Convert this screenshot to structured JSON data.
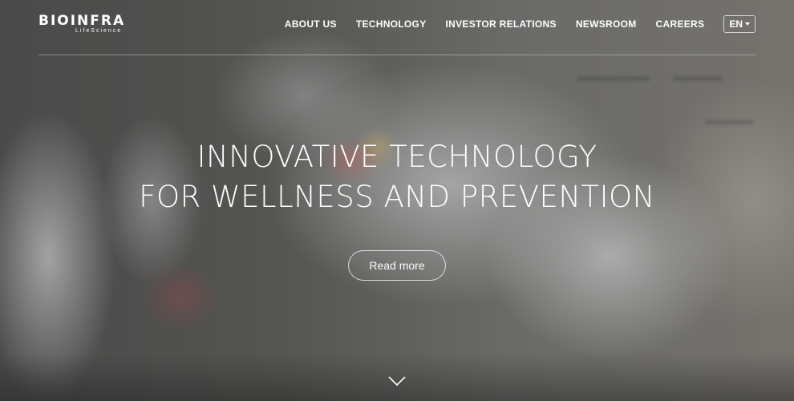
{
  "brand": {
    "logo_text": "BIOINFRA",
    "logo_subtext": "LifeScience"
  },
  "nav": {
    "items": [
      {
        "label": "ABOUT US"
      },
      {
        "label": "TECHNOLOGY"
      },
      {
        "label": "INVESTOR RELATIONS"
      },
      {
        "label": "NEWSROOM"
      },
      {
        "label": "CAREERS"
      }
    ],
    "language": "EN"
  },
  "hero": {
    "headline_line1": "INNOVATIVE TECHNOLOGY",
    "headline_line2": "FOR WELLNESS AND PREVENTION",
    "cta_label": "Read more"
  },
  "icons": {
    "scroll": "chevron-down-icon",
    "language_caret": "caret-down-icon"
  },
  "colors": {
    "text": "#ffffff",
    "overlay": "#282828"
  }
}
